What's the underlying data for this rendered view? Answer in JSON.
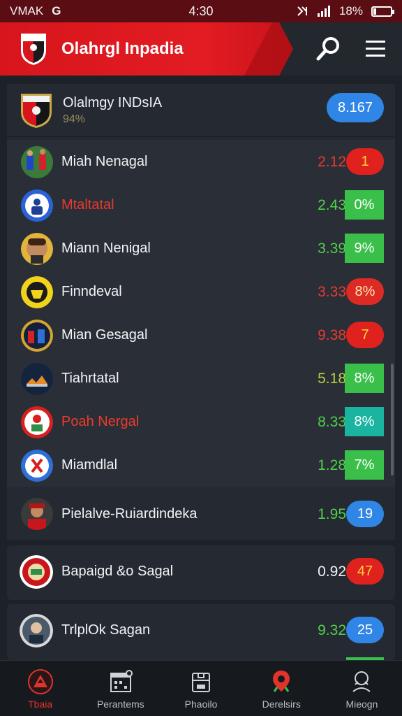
{
  "status_bar": {
    "carrier": "VMAK",
    "carrier_icon": "G",
    "time": "4:30",
    "battery": "18%",
    "battery_level": 0.18,
    "icons": [
      "nfc-icon",
      "signal-icon"
    ]
  },
  "header": {
    "title": "Olahrgl Inpadia",
    "brand_color": "#e21c22",
    "search_icon": "search-icon",
    "menu_icon": "menu-icon"
  },
  "featured": {
    "name": "Olalmgy INDsIA",
    "sub": "94%",
    "badge": "8.167"
  },
  "rows": [
    {
      "name": "Miah Nenagal",
      "value": "2.12",
      "value_color": "red",
      "badge": "1",
      "badge_type": "pill-red"
    },
    {
      "name": "Mtaltatal",
      "value": "2.43",
      "value_color": "green",
      "badge": "0%",
      "badge_type": "box-green"
    },
    {
      "name": "Miann Nenigal",
      "value": "3.39",
      "value_color": "green",
      "badge": "9%",
      "badge_type": "box-green"
    },
    {
      "name": "Finndeval",
      "value": "3.33",
      "value_color": "red",
      "badge": "8%",
      "badge_type": "pill-redlight"
    },
    {
      "name": "Mian Gesagal",
      "value": "9.38",
      "value_color": "red",
      "badge": "7",
      "badge_type": "pill-red"
    },
    {
      "name": "Tiahrtatal",
      "value": "5.18",
      "value_color": "mix",
      "badge": "8%",
      "badge_type": "box-green"
    },
    {
      "name": "Poah Nergal",
      "value": "8.33",
      "value_color": "green",
      "badge": "8%",
      "badge_type": "box-teal"
    },
    {
      "name": "Miamdlal",
      "value": "1.28",
      "value_color": "green",
      "badge": "7%",
      "badge_type": "box-green"
    },
    {
      "name": "Pielalve-Ruiardindeka",
      "value": "1.95",
      "value_color": "green",
      "badge": "19",
      "badge_type": "pill-blue"
    }
  ],
  "cards": [
    {
      "name": "Bapaigd &o Sagal",
      "value": "0.92",
      "badge": "47",
      "badge_type": "pill-red"
    },
    {
      "name": "TrlplOk Sagan",
      "value": "9.32",
      "badge": "25",
      "badge_type": "pill-blue"
    }
  ],
  "bottom_nav": [
    {
      "label": "Tbaia",
      "icon": "home-icon",
      "active": true
    },
    {
      "label": "Perantems",
      "icon": "calendar-icon",
      "active": false
    },
    {
      "label": "Phaoilo",
      "icon": "box-icon",
      "active": false
    },
    {
      "label": "Derelsirs",
      "icon": "location-icon",
      "active": false
    },
    {
      "label": "Mieogn",
      "icon": "profile-icon",
      "active": false
    }
  ]
}
